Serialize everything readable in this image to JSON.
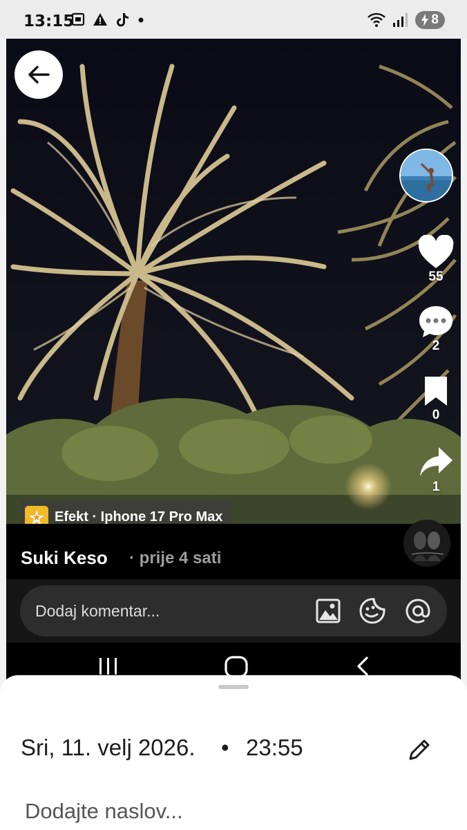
{
  "status_bar": {
    "time": "13:15",
    "left_icons": [
      "screenshot-icon",
      "warning-icon",
      "tiktok-icon",
      "dot-icon"
    ],
    "right_icons": [
      "wifi-icon",
      "signal-icon"
    ],
    "battery": "8"
  },
  "video": {
    "effect_label": "Efekt · Iphone 17 Pro Max",
    "author": "Suki Keso",
    "time_ago": "· prije 4 sati"
  },
  "actions": {
    "likes": "55",
    "comments": "2",
    "saves": "0",
    "shares": "1"
  },
  "comment": {
    "placeholder": "Dodaj komentar..."
  },
  "sheet": {
    "date": "Sri, 11. velj 2026.",
    "dot": "•",
    "time": "23:55",
    "title_placeholder": "Dodajte naslov..."
  }
}
